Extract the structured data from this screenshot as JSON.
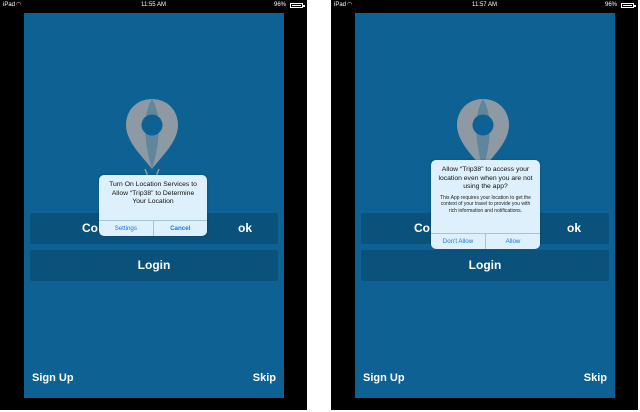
{
  "screens": [
    {
      "status": {
        "carrier": "iPad",
        "time": "11:55 AM",
        "battery": "96%"
      },
      "buttons": {
        "facebook": "Co",
        "facebook_tail": "ok",
        "login": "Login"
      },
      "footer": {
        "signup": "Sign Up",
        "skip": "Skip"
      },
      "alert": {
        "title": "Turn On Location Services to Allow “Trip38” to Determine Your Location",
        "message": "",
        "actions": [
          "Settings",
          "Cancel"
        ]
      }
    },
    {
      "status": {
        "carrier": "iPad",
        "time": "11:57 AM",
        "battery": "96%"
      },
      "buttons": {
        "facebook": "Co",
        "facebook_tail": "ok",
        "login": "Login"
      },
      "footer": {
        "signup": "Sign Up",
        "skip": "Skip"
      },
      "alert": {
        "title": "Allow “Trip38” to access your location even when you are not using the app?",
        "message": "This App requires your location to get the context of your travel to provide you with rich information and notifications.",
        "actions": [
          "Don't Allow",
          "Allow"
        ]
      }
    }
  ],
  "icons": {
    "logo": "hot-air-balloon-location-pin-icon",
    "wifi": "wifi-icon",
    "battery": "battery-icon"
  },
  "colors": {
    "screen_bg": "#0d6293",
    "button_bg": "#0a527c",
    "logo_gray": "#8d9aa3",
    "alert_bg": "#ddf0fb",
    "alert_action": "#1d77d8"
  }
}
